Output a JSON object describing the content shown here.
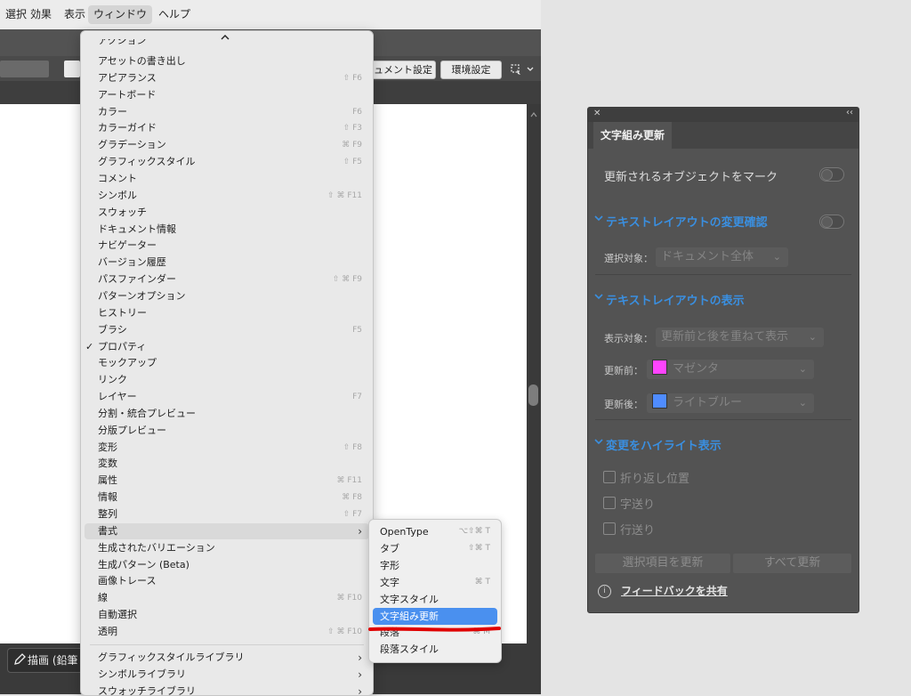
{
  "menubar": {
    "items": [
      "選択",
      "効果",
      "表示",
      "ウィンドウ",
      "ヘルプ"
    ],
    "active": "ウィンドウ"
  },
  "toolbar": {
    "doc_settings": "ュメント設定",
    "preferences": "環境設定"
  },
  "bottom": {
    "draw_mode": "描画 (鉛筆"
  },
  "window_menu": {
    "scroll_up": "^",
    "top_partial": "アクション",
    "items": [
      {
        "label": "アセットの書き出し",
        "shortcut": ""
      },
      {
        "label": "アピアランス",
        "shortcut": "⇧ F6"
      },
      {
        "label": "アートボード",
        "shortcut": ""
      },
      {
        "label": "カラー",
        "shortcut": "F6"
      },
      {
        "label": "カラーガイド",
        "shortcut": "⇧ F3"
      },
      {
        "label": "グラデーション",
        "shortcut": "⌘ F9"
      },
      {
        "label": "グラフィックスタイル",
        "shortcut": "⇧ F5"
      },
      {
        "label": "コメント",
        "shortcut": ""
      },
      {
        "label": "シンボル",
        "shortcut": "⇧ ⌘ F11"
      },
      {
        "label": "スウォッチ",
        "shortcut": ""
      },
      {
        "label": "ドキュメント情報",
        "shortcut": ""
      },
      {
        "label": "ナビゲーター",
        "shortcut": ""
      },
      {
        "label": "バージョン履歴",
        "shortcut": ""
      },
      {
        "label": "パスファインダー",
        "shortcut": "⇧ ⌘ F9"
      },
      {
        "label": "パターンオプション",
        "shortcut": ""
      },
      {
        "label": "ヒストリー",
        "shortcut": ""
      },
      {
        "label": "ブラシ",
        "shortcut": "F5"
      },
      {
        "label": "プロパティ",
        "shortcut": "",
        "checked": "✓"
      },
      {
        "label": "モックアップ",
        "shortcut": ""
      },
      {
        "label": "リンク",
        "shortcut": ""
      },
      {
        "label": "レイヤー",
        "shortcut": "F7"
      },
      {
        "label": "分割・統合プレビュー",
        "shortcut": ""
      },
      {
        "label": "分版プレビュー",
        "shortcut": ""
      },
      {
        "label": "変形",
        "shortcut": "⇧ F8"
      },
      {
        "label": "変数",
        "shortcut": ""
      },
      {
        "label": "属性",
        "shortcut": "⌘ F11"
      },
      {
        "label": "情報",
        "shortcut": "⌘ F8"
      },
      {
        "label": "整列",
        "shortcut": "⇧ F7"
      },
      {
        "label": "書式",
        "shortcut": "",
        "submenu": "›",
        "highlighted": true
      },
      {
        "label": "生成されたバリエーション",
        "shortcut": ""
      },
      {
        "label": "生成パターン (Beta)",
        "shortcut": ""
      },
      {
        "label": "画像トレース",
        "shortcut": ""
      },
      {
        "label": "線",
        "shortcut": "⌘ F10"
      },
      {
        "label": "自動選択",
        "shortcut": ""
      },
      {
        "label": "透明",
        "shortcut": "⇧ ⌘ F10"
      }
    ],
    "libraries": [
      {
        "label": "グラフィックスタイルライブラリ",
        "submenu": "›"
      },
      {
        "label": "シンボルライブラリ",
        "submenu": "›"
      },
      {
        "label": "スウォッチライブラリ",
        "submenu": "›"
      }
    ]
  },
  "type_submenu": {
    "items": [
      {
        "label": "OpenType",
        "shortcut": "⌥⇧⌘ T"
      },
      {
        "label": "タブ",
        "shortcut": "⇧⌘ T"
      },
      {
        "label": "字形",
        "shortcut": ""
      },
      {
        "label": "文字",
        "shortcut": "⌘ T"
      },
      {
        "label": "文字スタイル",
        "shortcut": ""
      },
      {
        "label": "文字組み更新",
        "shortcut": "",
        "selected": true
      },
      {
        "label": "段落",
        "shortcut": "⌘ M"
      },
      {
        "label": "段落スタイル",
        "shortcut": ""
      }
    ]
  },
  "panel": {
    "close_glyph": "✕",
    "collapse_glyph": "‹‹",
    "tab": "文字組み更新",
    "mark_updated": "更新されるオブジェクトをマーク",
    "sec_confirm": "テキストレイアウトの変更確認",
    "target_label": "選択対象：",
    "target_value": "ドキュメント全体",
    "sec_display": "テキストレイアウトの表示",
    "display_label": "表示対象：",
    "display_value": "更新前と後を重ねて表示",
    "before_label": "更新前：",
    "before_value": "マゼンタ",
    "before_color": "#ff44ff",
    "after_label": "更新後：",
    "after_value": "ライトブルー",
    "after_color": "#4f8cff",
    "sec_highlight": "変更をハイライト表示",
    "cb_wrap": "折り返し位置",
    "cb_tracking": "字送り",
    "cb_leading": "行送り",
    "btn_update_selected": "選択項目を更新",
    "btn_update_all": "すべて更新",
    "info_glyph": "i",
    "feedback": "フィードバックを共有",
    "section_chevron": "⌄"
  },
  "colors": {
    "panel_bg": "#535353",
    "accent_blue": "#3a8fe0",
    "selection_blue": "#4a90ef",
    "annotation_red": "#e00000"
  }
}
